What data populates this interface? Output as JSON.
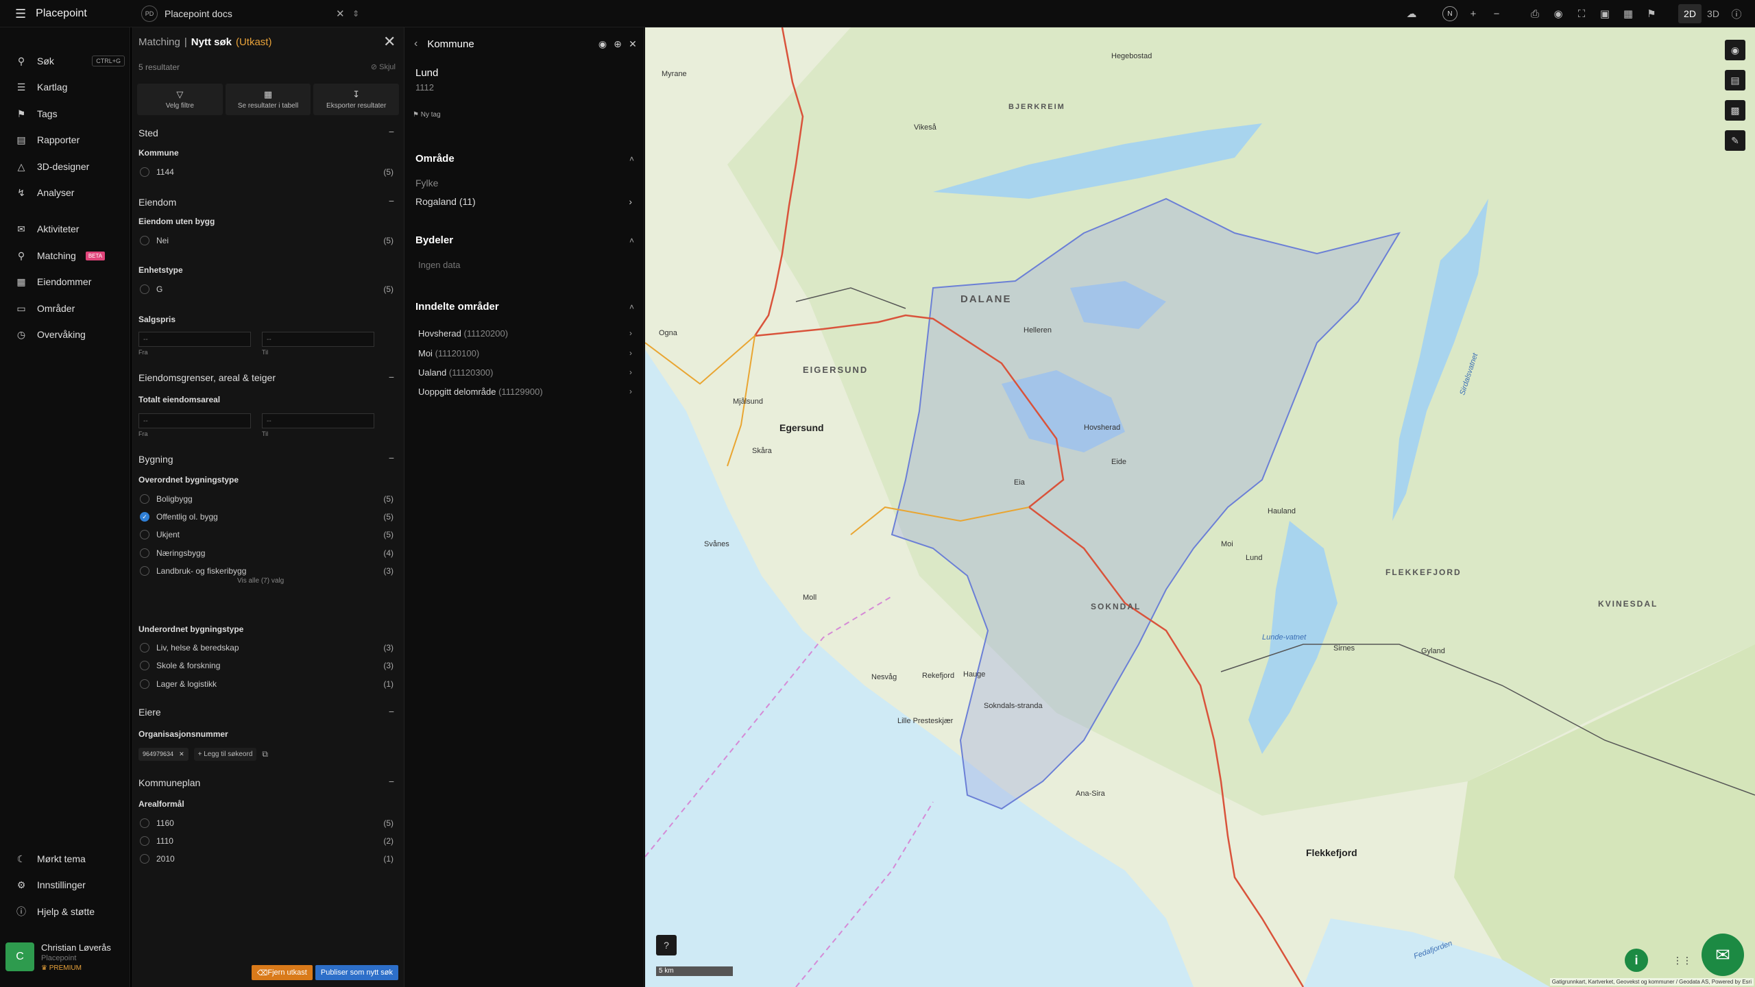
{
  "app": {
    "name": "Placepoint",
    "workspace_initials": "PD",
    "workspace": "Placepoint docs"
  },
  "toolbar": {
    "compass": "N",
    "mode_2d": "2D",
    "mode_3d": "3D"
  },
  "sidebar": {
    "items": [
      {
        "label": "Søk",
        "shortcut": "CTRL+G",
        "icon": "search-icon"
      },
      {
        "label": "Kartlag",
        "icon": "layers-icon"
      },
      {
        "label": "Tags",
        "icon": "bookmark-icon"
      },
      {
        "label": "Rapporter",
        "icon": "chart-icon"
      },
      {
        "label": "3D-designer",
        "icon": "cube-icon"
      },
      {
        "label": "Analyser",
        "icon": "bolt-icon"
      },
      {
        "label": "Aktiviteter",
        "icon": "activity-icon"
      },
      {
        "label": "Matching",
        "badge": "BETA",
        "icon": "matching-icon"
      },
      {
        "label": "Eiendommer",
        "icon": "grid-icon"
      },
      {
        "label": "Områder",
        "icon": "area-icon"
      },
      {
        "label": "Overvåking",
        "icon": "watch-icon"
      }
    ],
    "bottom": [
      {
        "label": "Mørkt tema",
        "icon": "moon-icon"
      },
      {
        "label": "Innstillinger",
        "icon": "gear-icon"
      },
      {
        "label": "Hjelp & støtte",
        "icon": "help-icon"
      }
    ],
    "user": {
      "initial": "C",
      "name": "Christian Løverås",
      "org": "Placepoint",
      "plan": "PREMIUM"
    }
  },
  "filter": {
    "crumb_parent": "Matching",
    "crumb_sep": "|",
    "crumb_current": "Nytt søk",
    "crumb_status": "(Utkast)",
    "results": "5 resultater",
    "hide": "Skjul",
    "actions": {
      "filters": "Velg filtre",
      "table": "Se resultater i tabell",
      "export": "Eksporter resultater"
    },
    "sections": {
      "sted": "Sted",
      "eiendom": "Eiendom",
      "grenser": "Eiendomsgrenser, areal & teiger",
      "bygning": "Bygning",
      "eiere": "Eiere",
      "kommuneplan": "Kommuneplan"
    },
    "subs": {
      "kommune": "Kommune",
      "uten_bygg": "Eiendom uten bygg",
      "enhetstype": "Enhetstype",
      "salgspris": "Salgspris",
      "totalareal": "Totalt eiendomsareal",
      "overordnet": "Overordnet bygningstype",
      "underordnet": "Underordnet bygningstype",
      "orgnr": "Organisasjonsnummer",
      "arealformal": "Arealformål"
    },
    "kommune_opts": [
      {
        "label": "1144",
        "count": "(5)"
      }
    ],
    "uten_bygg_opts": [
      {
        "label": "Nei",
        "count": "(5)"
      }
    ],
    "enhetstype_opts": [
      {
        "label": "G",
        "count": "(5)"
      }
    ],
    "range": {
      "from_placeholder": "--",
      "to_placeholder": "--",
      "from": "Fra",
      "to": "Til"
    },
    "overordnet_opts": [
      {
        "label": "Boligbygg",
        "count": "(5)"
      },
      {
        "label": "Offentlig ol. bygg",
        "count": "(5)",
        "checked": true
      },
      {
        "label": "Ukjent",
        "count": "(5)"
      },
      {
        "label": "Næringsbygg",
        "count": "(4)"
      },
      {
        "label": "Landbruk- og fiskeribygg",
        "count": "(3)"
      }
    ],
    "show_all": "Vis alle (7) valg",
    "underordnet_opts": [
      {
        "label": "Liv, helse & beredskap",
        "count": "(3)"
      },
      {
        "label": "Skole & forskning",
        "count": "(3)"
      },
      {
        "label": "Lager & logistikk",
        "count": "(1)"
      }
    ],
    "orgnr_tag": "964979634",
    "add_keyword": "Legg til søkeord",
    "arealformal_opts": [
      {
        "label": "1160",
        "count": "(5)"
      },
      {
        "label": "1110",
        "count": "(2)"
      },
      {
        "label": "2010",
        "count": "(1)"
      }
    ],
    "btn_remove": "Fjern utkast",
    "btn_publish": "Publiser som nytt søk"
  },
  "detail": {
    "title": "Kommune",
    "name": "Lund",
    "code": "1112",
    "new_tag": "Ny tag",
    "omrade": "Område",
    "fylke_label": "Fylke",
    "fylke_value": "Rogaland (11)",
    "bydeler": "Bydeler",
    "no_data": "Ingen data",
    "inndelte": "Inndelte områder",
    "areas": [
      {
        "name": "Hovsherad",
        "code": "(11120200)"
      },
      {
        "name": "Moi",
        "code": "(11120100)"
      },
      {
        "name": "Ualand",
        "code": "(11120300)"
      },
      {
        "name": "Uoppgitt delområde",
        "code": "(11129900)"
      }
    ]
  },
  "map": {
    "labels": {
      "dalane": "DALANE",
      "bjerkreim": "BJERKREIM",
      "eigersund": "EIGERSUND",
      "sokndal": "SOKNDAL",
      "flekkefjord": "FLEKKEFJORD",
      "kvinesdal": "KVINESDAL",
      "egersund": "Egersund",
      "flekkefjord_town": "Flekkefjord",
      "moi": "Moi",
      "lund": "Lund",
      "hauge": "Hauge",
      "vikeså": "Vikeså",
      "helleren": "Helleren",
      "eia": "Eia",
      "hovsherad": "Hovsherad",
      "sokndalsstranda": "Sokndals-stranda",
      "rekefjord": "Rekefjord",
      "lundevatnet": "Lunde-vatnet",
      "sirdalsvatnet": "Sirdalsvatnet",
      "fedafjorden": "Fedafjorden",
      "ogna": "Ogna",
      "myrane": "Myrane",
      "hegebostad": "Hegebostad",
      "mjallsund": "Mjålsund",
      "skara": "Skåra",
      "svanes": "Svånes",
      "lille_presteskjær": "Lille Presteskjær",
      "nesvag": "Nesvåg",
      "moll": "Moll",
      "ana_sira": "Ana-Sira",
      "sirnes": "Sirnes",
      "gyland": "Gyland",
      "eide": "Eide",
      "hauland": "Hauland"
    },
    "scale": "5 km",
    "attribution": "Gatigrunnkart, Kartverket, Geovekst og kommuner / Geodata AS, Powered by Esri"
  }
}
